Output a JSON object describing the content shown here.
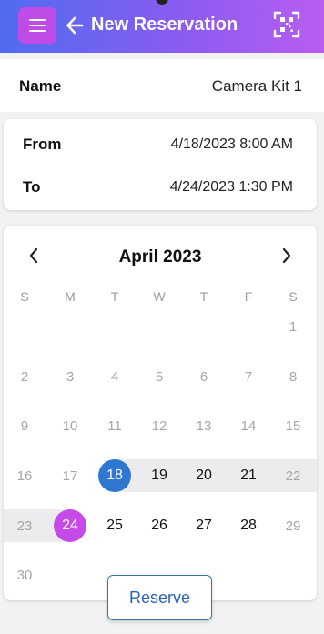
{
  "header": {
    "title": "New Reservation",
    "menu_icon": "hamburger-icon",
    "back_icon": "arrow-left-icon",
    "scan_icon": "qr-scan-icon"
  },
  "item": {
    "label": "Name",
    "value": "Camera Kit 1"
  },
  "dates": {
    "from_label": "From",
    "from_value": "4/18/2023 8:00 AM",
    "to_label": "To",
    "to_value": "4/24/2023 1:30 PM"
  },
  "calendar": {
    "month_label": "April 2023",
    "prev_icon": "chevron-left-icon",
    "next_icon": "chevron-right-icon",
    "weekdays": [
      "S",
      "M",
      "T",
      "W",
      "T",
      "F",
      "S"
    ],
    "weeks": [
      [
        "",
        "",
        "",
        "",
        "",
        "",
        "1"
      ],
      [
        "2",
        "3",
        "4",
        "5",
        "6",
        "7",
        "8"
      ],
      [
        "9",
        "10",
        "11",
        "12",
        "13",
        "14",
        "15"
      ],
      [
        "16",
        "17",
        "18",
        "19",
        "20",
        "21",
        "22"
      ],
      [
        "23",
        "24",
        "25",
        "26",
        "27",
        "28",
        "29"
      ],
      [
        "30",
        "",
        "",
        "",
        "",
        "",
        ""
      ]
    ],
    "selected_start": "18",
    "selected_end": "24",
    "colors": {
      "start": "#2f78d2",
      "end": "#c54ae8",
      "range": "#ececee"
    }
  },
  "actions": {
    "reserve_label": "Reserve"
  }
}
